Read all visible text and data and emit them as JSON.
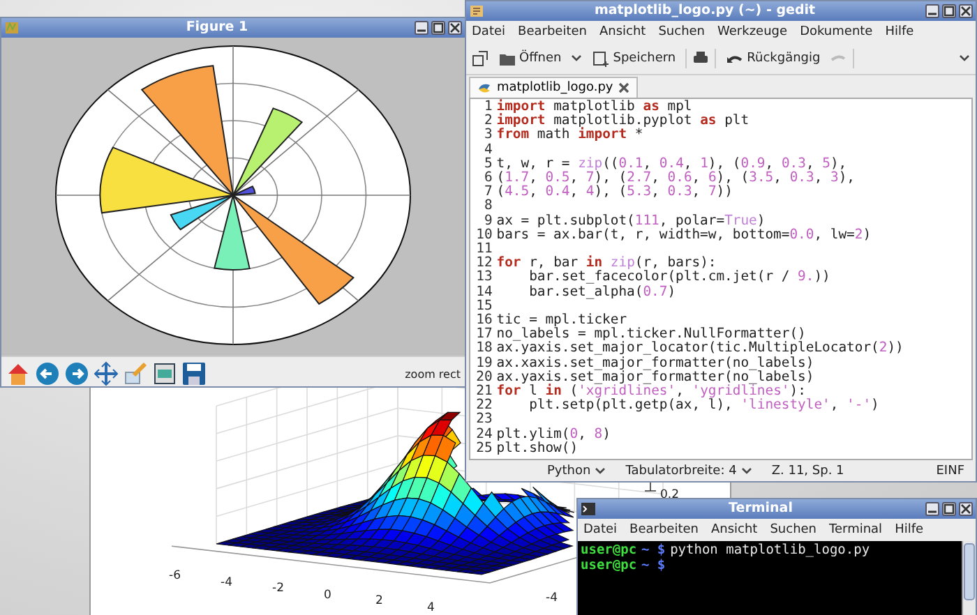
{
  "figure_window": {
    "title": "Figure 1",
    "toolbar_status": "zoom rect"
  },
  "surface_window": {
    "x_ticks": [
      "-6",
      "-4",
      "-2",
      "0",
      "2",
      "4"
    ],
    "y_ticks": [
      "-4"
    ],
    "z_ticks": [
      "0.2"
    ]
  },
  "editor": {
    "title": "matplotlib_logo.py (~) - gedit",
    "menu": [
      "Datei",
      "Bearbeiten",
      "Ansicht",
      "Suchen",
      "Werkzeuge",
      "Dokumente",
      "Hilfe"
    ],
    "toolbar": [
      {
        "kind": "open",
        "label": "Öffnen"
      },
      {
        "kind": "save",
        "label": "Speichern"
      },
      {
        "kind": "undo",
        "label": "Rückgängig"
      }
    ],
    "tabs": [
      {
        "label": "matplotlib_logo.py",
        "selected": true
      }
    ],
    "lines": [
      {
        "number": "1",
        "segments": [
          {
            "kind": "keyword",
            "text": "import"
          },
          {
            "kind": "plain",
            "text": " matplotlib "
          },
          {
            "kind": "keyword",
            "text": "as"
          },
          {
            "kind": "plain",
            "text": " mpl"
          }
        ]
      },
      {
        "number": "2",
        "segments": [
          {
            "kind": "keyword",
            "text": "import"
          },
          {
            "kind": "plain",
            "text": " matplotlib.pyplot "
          },
          {
            "kind": "keyword",
            "text": "as"
          },
          {
            "kind": "plain",
            "text": " plt"
          }
        ]
      },
      {
        "number": "3",
        "segments": [
          {
            "kind": "keyword",
            "text": "from"
          },
          {
            "kind": "plain",
            "text": " math "
          },
          {
            "kind": "keyword",
            "text": "import"
          },
          {
            "kind": "plain",
            "text": " *"
          }
        ]
      },
      {
        "number": "4"
      },
      {
        "number": "5",
        "segments": [
          {
            "kind": "plain",
            "text": "t, w, r = "
          },
          {
            "kind": "builtin",
            "text": "zip"
          },
          {
            "kind": "plain",
            "text": "(("
          },
          {
            "kind": "literal",
            "text": "0.1"
          },
          {
            "kind": "plain",
            "text": ", "
          },
          {
            "kind": "literal",
            "text": "0.4"
          },
          {
            "kind": "plain",
            "text": ", "
          },
          {
            "kind": "literal",
            "text": "1"
          },
          {
            "kind": "plain",
            "text": "), ("
          },
          {
            "kind": "literal",
            "text": "0.9"
          },
          {
            "kind": "plain",
            "text": ", "
          },
          {
            "kind": "literal",
            "text": "0.3"
          },
          {
            "kind": "plain",
            "text": ", "
          },
          {
            "kind": "literal",
            "text": "5"
          },
          {
            "kind": "plain",
            "text": "),"
          }
        ]
      },
      {
        "number": "6",
        "segments": [
          {
            "kind": "plain",
            "text": "("
          },
          {
            "kind": "literal",
            "text": "1.7"
          },
          {
            "kind": "plain",
            "text": ", "
          },
          {
            "kind": "literal",
            "text": "0.5"
          },
          {
            "kind": "plain",
            "text": ", "
          },
          {
            "kind": "literal",
            "text": "7"
          },
          {
            "kind": "plain",
            "text": "), ("
          },
          {
            "kind": "literal",
            "text": "2.7"
          },
          {
            "kind": "plain",
            "text": ", "
          },
          {
            "kind": "literal",
            "text": "0.6"
          },
          {
            "kind": "plain",
            "text": ", "
          },
          {
            "kind": "literal",
            "text": "6"
          },
          {
            "kind": "plain",
            "text": "), ("
          },
          {
            "kind": "literal",
            "text": "3.5"
          },
          {
            "kind": "plain",
            "text": ", "
          },
          {
            "kind": "literal",
            "text": "0.3"
          },
          {
            "kind": "plain",
            "text": ", "
          },
          {
            "kind": "literal",
            "text": "3"
          },
          {
            "kind": "plain",
            "text": "),"
          }
        ]
      },
      {
        "number": "7",
        "segments": [
          {
            "kind": "plain",
            "text": "("
          },
          {
            "kind": "literal",
            "text": "4.5"
          },
          {
            "kind": "plain",
            "text": ", "
          },
          {
            "kind": "literal",
            "text": "0.4"
          },
          {
            "kind": "plain",
            "text": ", "
          },
          {
            "kind": "literal",
            "text": "4"
          },
          {
            "kind": "plain",
            "text": "), ("
          },
          {
            "kind": "literal",
            "text": "5.3"
          },
          {
            "kind": "plain",
            "text": ", "
          },
          {
            "kind": "literal",
            "text": "0.3"
          },
          {
            "kind": "plain",
            "text": ", "
          },
          {
            "kind": "literal",
            "text": "7"
          },
          {
            "kind": "plain",
            "text": "))"
          }
        ]
      },
      {
        "number": "8"
      },
      {
        "number": "9",
        "segments": [
          {
            "kind": "plain",
            "text": "ax = plt.subplot("
          },
          {
            "kind": "literal",
            "text": "111"
          },
          {
            "kind": "plain",
            "text": ", polar="
          },
          {
            "kind": "builtin",
            "text": "True"
          },
          {
            "kind": "plain",
            "text": ")"
          }
        ]
      },
      {
        "number": "10",
        "segments": [
          {
            "kind": "plain",
            "text": "bars = ax.bar(t, r, width=w, bottom="
          },
          {
            "kind": "literal",
            "text": "0.0"
          },
          {
            "kind": "plain",
            "text": ", lw="
          },
          {
            "kind": "literal",
            "text": "2"
          },
          {
            "kind": "plain",
            "text": ")"
          }
        ]
      },
      {
        "number": "11"
      },
      {
        "number": "12",
        "segments": [
          {
            "kind": "keyword",
            "text": "for"
          },
          {
            "kind": "plain",
            "text": " r, bar "
          },
          {
            "kind": "keyword",
            "text": "in"
          },
          {
            "kind": "builtin",
            "text": " zip"
          },
          {
            "kind": "plain",
            "text": "(r, bars):"
          }
        ]
      },
      {
        "number": "13",
        "segments": [
          {
            "kind": "plain",
            "text": "    bar.set_facecolor(plt.cm.jet(r / "
          },
          {
            "kind": "literal",
            "text": "9."
          },
          {
            "kind": "plain",
            "text": "))"
          }
        ]
      },
      {
        "number": "14",
        "segments": [
          {
            "kind": "plain",
            "text": "    bar.set_alpha("
          },
          {
            "kind": "literal",
            "text": "0.7"
          },
          {
            "kind": "plain",
            "text": ")"
          }
        ]
      },
      {
        "number": "15"
      },
      {
        "number": "16",
        "segments": [
          {
            "kind": "plain",
            "text": "tic = mpl.ticker"
          }
        ]
      },
      {
        "number": "17",
        "segments": [
          {
            "kind": "plain",
            "text": "no_labels = mpl.ticker.NullFormatter()"
          }
        ]
      },
      {
        "number": "18",
        "segments": [
          {
            "kind": "plain",
            "text": "ax.yaxis.set_major_locator(tic.MultipleLocator("
          },
          {
            "kind": "literal",
            "text": "2"
          },
          {
            "kind": "plain",
            "text": "))"
          }
        ]
      },
      {
        "number": "19",
        "segments": [
          {
            "kind": "plain",
            "text": "ax.xaxis.set_major_formatter(no_labels)"
          }
        ]
      },
      {
        "number": "20",
        "segments": [
          {
            "kind": "plain",
            "text": "ax.yaxis.set_major_formatter(no_labels)"
          }
        ]
      },
      {
        "number": "21",
        "segments": [
          {
            "kind": "keyword",
            "text": "for"
          },
          {
            "kind": "plain",
            "text": " l "
          },
          {
            "kind": "keyword",
            "text": "in"
          },
          {
            "kind": "plain",
            "text": " ("
          },
          {
            "kind": "literal",
            "text": "'xgridlines'"
          },
          {
            "kind": "plain",
            "text": ", "
          },
          {
            "kind": "literal",
            "text": "'ygridlines'"
          },
          {
            "kind": "plain",
            "text": "):"
          }
        ]
      },
      {
        "number": "22",
        "segments": [
          {
            "kind": "plain",
            "text": "    plt.setp(plt.getp(ax, l), "
          },
          {
            "kind": "literal",
            "text": "'linestyle'"
          },
          {
            "kind": "plain",
            "text": ", "
          },
          {
            "kind": "literal",
            "text": "'-'"
          },
          {
            "kind": "plain",
            "text": ")"
          }
        ]
      },
      {
        "number": "23"
      },
      {
        "number": "24",
        "segments": [
          {
            "kind": "plain",
            "text": "plt.ylim("
          },
          {
            "kind": "literal",
            "text": "0"
          },
          {
            "kind": "plain",
            "text": ", "
          },
          {
            "kind": "literal",
            "text": "8"
          },
          {
            "kind": "plain",
            "text": ")"
          }
        ]
      },
      {
        "number": "25",
        "segments": [
          {
            "kind": "plain",
            "text": "plt.show()"
          }
        ]
      }
    ],
    "status_bar": [
      {
        "text": "Python",
        "dropdown": true
      },
      {
        "text": "Tabulatorbreite: 4",
        "dropdown": true
      },
      {
        "text": "Z. 11, Sp. 1",
        "dropdown": false
      },
      {
        "text": "EINF",
        "dropdown": false
      }
    ]
  },
  "terminal": {
    "title": "Terminal",
    "menu": [
      "Datei",
      "Bearbeiten",
      "Ansicht",
      "Suchen",
      "Terminal",
      "Hilfe"
    ],
    "lines": [
      {
        "user": "user@pc",
        "path": "~ $",
        "command": "python matplotlib_logo.py"
      },
      {
        "user": "user@pc",
        "path": "~ $"
      }
    ]
  }
}
